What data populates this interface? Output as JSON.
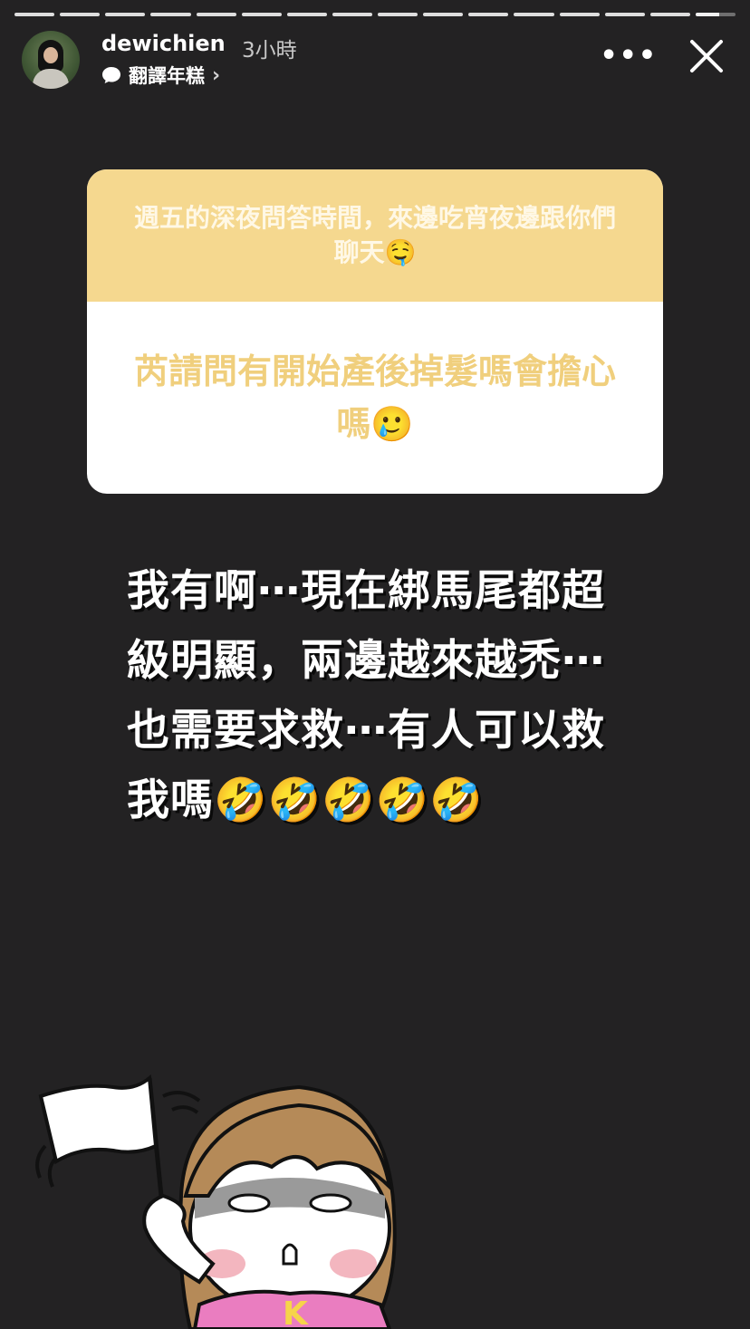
{
  "story": {
    "segments_total": 16,
    "current_segment_progress": 0.6
  },
  "header": {
    "username": "dewichien",
    "time_ago": "3小時",
    "sub_label": "翻譯年糕",
    "more_icon": "more-horizontal-icon",
    "close_icon": "close-icon"
  },
  "question_box": {
    "prompt": "週五的深夜問答時間，來邊吃宵夜邊跟你們聊天🤤",
    "question": "芮請問有開始產後掉髮嗎會擔心嗎🥲",
    "colors": {
      "header_bg": "#f5d88f",
      "question_text": "#f0cf7d"
    }
  },
  "answer_text": "我有啊⋯現在綁馬尾都超級明顯，兩邊越來越禿⋯也需要求救⋯有人可以救我嗎🤣🤣🤣🤣🤣",
  "sticker": {
    "icon": "girl-waving-white-flag-sticker",
    "shirt_letter": "K"
  }
}
